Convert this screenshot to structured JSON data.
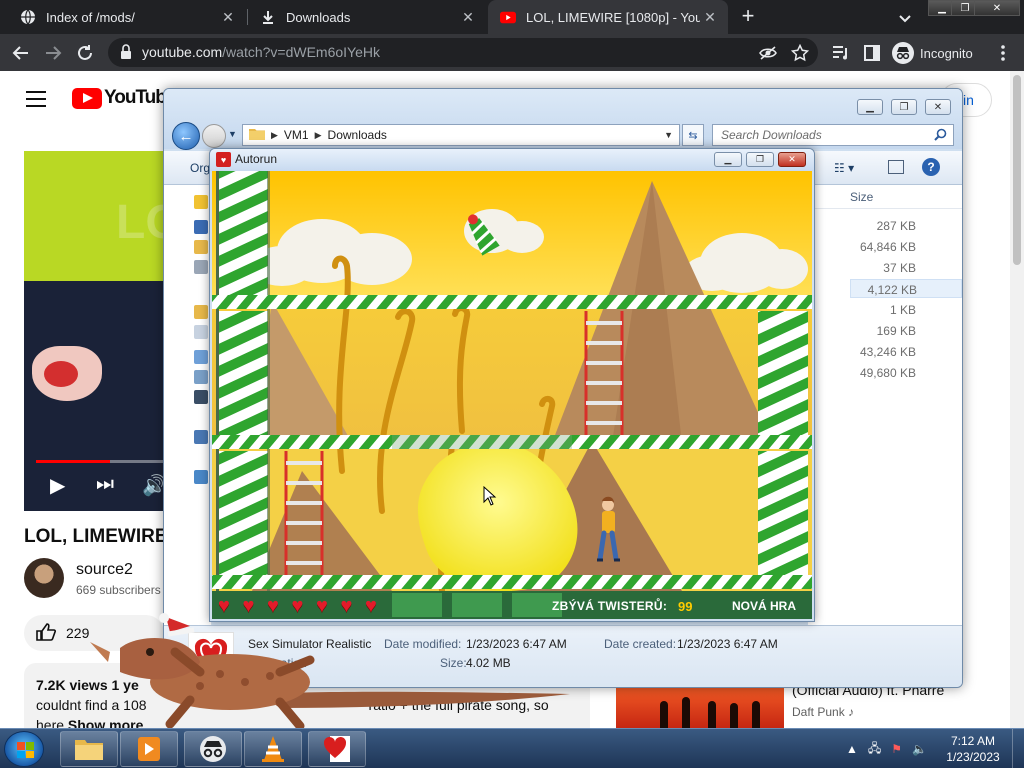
{
  "browser": {
    "tabs": [
      {
        "label": "Index of /mods/",
        "icon": "globe-icon"
      },
      {
        "label": "Downloads",
        "icon": "download-icon"
      },
      {
        "label": "LOL, LIMEWIRE [1080p] - YouTube",
        "icon": "youtube-icon",
        "active": true
      }
    ],
    "url_host": "youtube.com",
    "url_path": "/watch?v=dWEm6oIYeHk",
    "profile_label": "Incognito"
  },
  "youtube": {
    "logo_text": "YouTube",
    "signin_label": "in",
    "video_title": "LOL, LIMEWIRE",
    "channel_name": "source2",
    "subscribers": "669 subscribers",
    "likes": "229",
    "views": "7.2K views",
    "desc_date": "1 ye",
    "desc_line1": "couldnt find a 108",
    "desc_line1_end": "ratio + the full pirate song, so",
    "desc_line2": "here",
    "show_more": "Show more",
    "player_overlay": "LO",
    "rec_title": "(Official Audio) ft. Pharre",
    "rec_channel": "Daft Punk"
  },
  "explorer": {
    "breadcrumb": [
      "VM1",
      "Downloads"
    ],
    "search_placeholder": "Search Downloads",
    "organize_label": "Org",
    "column_size": "Size",
    "sizes": [
      "287 KB",
      "64,846 KB",
      "37 KB",
      "4,122 KB",
      "1 KB",
      "169 KB",
      "43,246 KB",
      "49,680 KB"
    ],
    "selected_index": 3,
    "details": {
      "name": "Sex Simulator Realistic",
      "type": "Application",
      "date_modified_label": "Date modified:",
      "date_modified": "1/23/2023 6:47 AM",
      "date_created_label": "Date created:",
      "date_created": "1/23/2023 6:47 AM",
      "size_label": "Size:",
      "size": "4.02 MB"
    }
  },
  "autorun": {
    "title": "Autorun",
    "lives": 7,
    "twisters_label": "ZBÝVÁ TWISTERŮ:",
    "twisters_count": "99",
    "new_game_label": "NOVÁ HRA"
  },
  "taskbar": {
    "time": "7:12 AM",
    "date": "1/23/2023"
  }
}
